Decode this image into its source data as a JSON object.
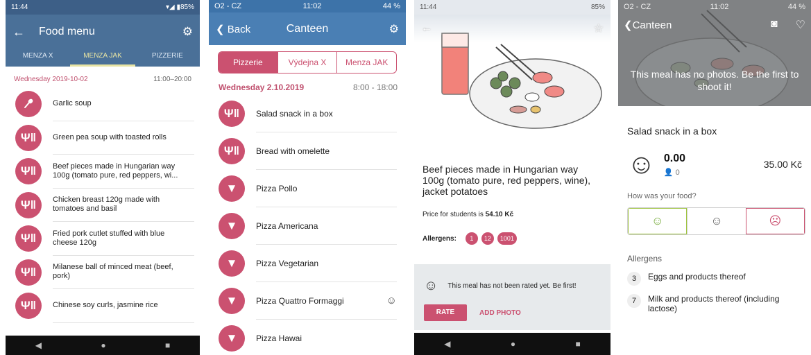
{
  "p1": {
    "status_time": "11:44",
    "status_battery": "▾◢ ▮85%",
    "title": "Food menu",
    "tabs": [
      "MENZA X",
      "MENZA JAK",
      "PIZZERIE"
    ],
    "date": "Wednesday 2019-10-02",
    "hours": "11:00–20:00",
    "items": [
      {
        "icon": "spoon-icon",
        "label": "Garlic soup"
      },
      {
        "icon": "fork-knife-icon",
        "label": "Green pea soup with toasted rolls"
      },
      {
        "icon": "fork-knife-icon",
        "label": "Beef pieces made in Hungarian way 100g (tomato pure, red peppers, wi..."
      },
      {
        "icon": "fork-knife-icon",
        "label": "Chicken breast 120g made with tomatoes and basil"
      },
      {
        "icon": "fork-knife-icon",
        "label": "Fried pork cutlet stuffed with blue cheese 120g"
      },
      {
        "icon": "fork-knife-icon",
        "label": "Milanese ball of minced meat (beef, pork)"
      },
      {
        "icon": "fork-knife-icon",
        "label": "Chinese soy curls, jasmine rice"
      }
    ]
  },
  "p2": {
    "status_carrier": "O2 - CZ",
    "status_time": "11:02",
    "status_battery": "44 %",
    "back_label": "Back",
    "title": "Canteen",
    "segments": [
      "Pizzerie",
      "Výdejna X",
      "Menza JAK"
    ],
    "date": "Wednesday 2.10.2019",
    "hours": "8:00 - 18:00",
    "items": [
      {
        "icon": "fork-knife-icon",
        "label": "Salad snack in a box"
      },
      {
        "icon": "fork-knife-icon",
        "label": "Bread with omelette"
      },
      {
        "icon": "pizza-icon",
        "label": "Pizza Pollo"
      },
      {
        "icon": "pizza-icon",
        "label": "Pizza Americana"
      },
      {
        "icon": "pizza-icon",
        "label": "Pizza Vegetarian"
      },
      {
        "icon": "pizza-icon",
        "label": "Pizza Quattro Formaggi",
        "rated": true
      },
      {
        "icon": "pizza-icon",
        "label": "Pizza Hawai"
      }
    ]
  },
  "p3": {
    "status_time": "11:44",
    "status_battery": "85%",
    "title": "Beef pieces made in Hungarian way 100g (tomato pure, red peppers, wine), jacket potatoes",
    "price_prefix": "Price for students is ",
    "price_value": "54.10 Kč",
    "allergens_label": "Allergens:",
    "allergens": [
      "1",
      "12",
      "1001"
    ],
    "rating_message": "This meal has not been rated yet. Be first!",
    "rate_label": "RATE",
    "add_photo_label": "ADD PHOTO"
  },
  "p4": {
    "status_carrier": "O2 - CZ",
    "status_time": "11:02",
    "status_battery": "44 %",
    "back_label": "Canteen",
    "no_photo_message": "This meal has no photos. Be the first to shoot it!",
    "title": "Salad snack in a box",
    "score": "0.00",
    "votes": "0",
    "price": "35.00 Kč",
    "question": "How was your food?",
    "allergens_header": "Allergens",
    "allergens": [
      {
        "num": "3",
        "label": "Eggs and products thereof"
      },
      {
        "num": "7",
        "label": "Milk and products thereof (including lactose)"
      }
    ]
  },
  "colors": {
    "accent": "#cb5170",
    "android_bar": "#4a7098",
    "ios_bar": "#4a7fb4",
    "good": "#6ca52c"
  }
}
